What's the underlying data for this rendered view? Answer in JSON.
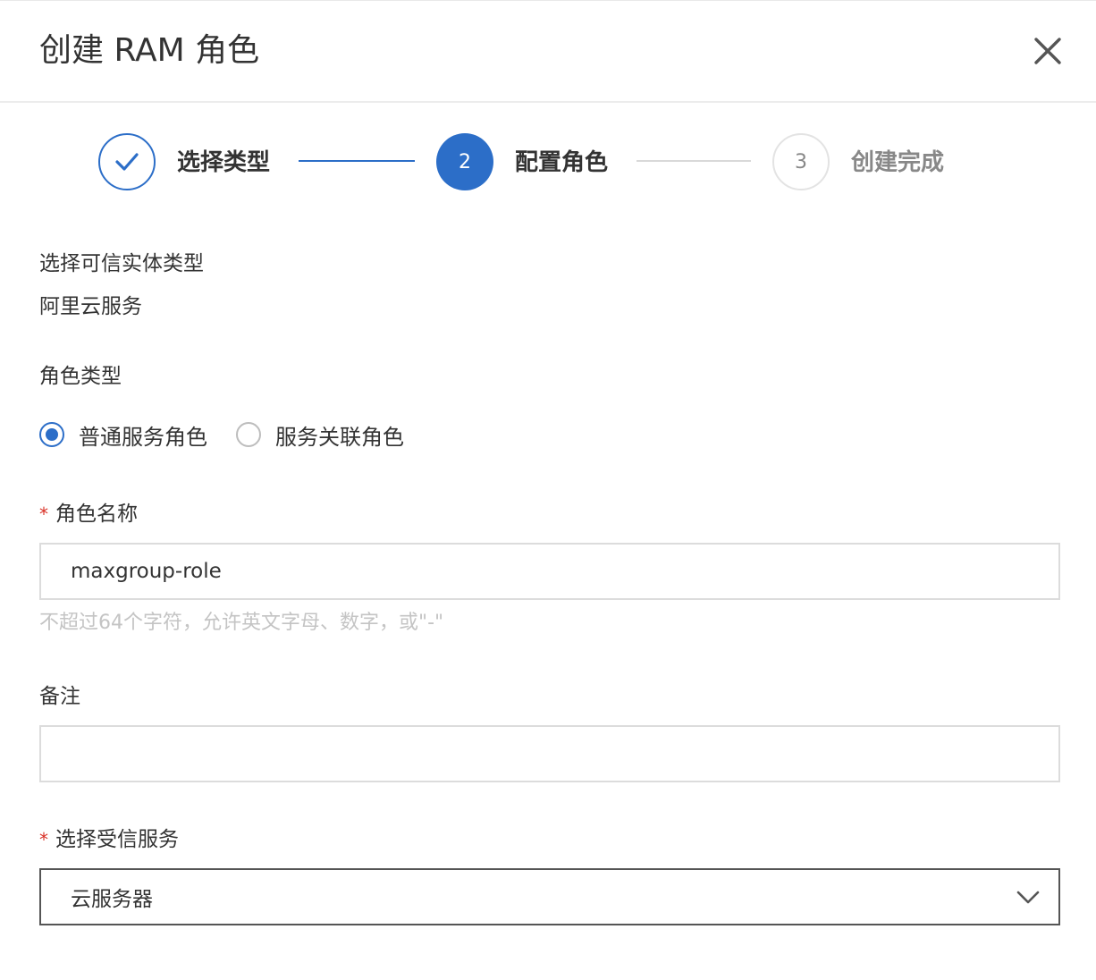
{
  "dialog": {
    "title": "创建 RAM 角色",
    "close_icon": "close-icon"
  },
  "steps": [
    {
      "number": "1",
      "label": "选择类型",
      "status": "done",
      "icon": "check-icon"
    },
    {
      "number": "2",
      "label": "配置角色",
      "status": "active"
    },
    {
      "number": "3",
      "label": "创建完成",
      "status": "pending"
    }
  ],
  "form": {
    "trusted_entity": {
      "label": "选择可信实体类型",
      "value": "阿里云服务"
    },
    "role_type": {
      "label": "角色类型",
      "options": [
        {
          "label": "普通服务角色",
          "checked": true
        },
        {
          "label": "服务关联角色",
          "checked": false
        }
      ]
    },
    "role_name": {
      "required_mark": "*",
      "label": "角色名称",
      "value": "maxgroup-role",
      "hint": "不超过64个字符，允许英文字母、数字，或\"-\""
    },
    "remark": {
      "label": "备注",
      "value": ""
    },
    "trusted_service": {
      "required_mark": "*",
      "label": "选择受信服务",
      "value": "云服务器",
      "icon": "chevron-down-icon"
    }
  },
  "colors": {
    "accent": "#2c6ec8",
    "required": "#d93026",
    "hint": "#c4c4c4"
  }
}
